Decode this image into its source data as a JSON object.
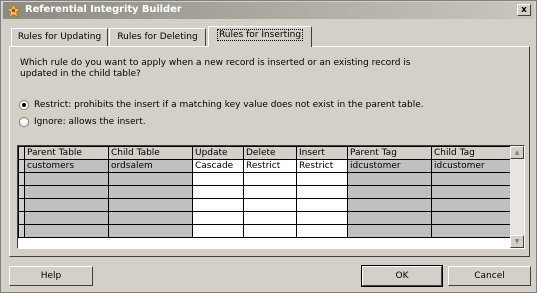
{
  "window": {
    "title": "Referential Integrity Builder",
    "close_glyph": "x"
  },
  "tabs": [
    {
      "label": "Rules for Updating",
      "active": false
    },
    {
      "label": "Rules for Deleting",
      "active": false
    },
    {
      "label": "Rules for Inserting",
      "active": true
    }
  ],
  "question": "Which rule do you want to apply when a new record is inserted or an existing record is updated in the child table?",
  "options": [
    {
      "label": "Restrict: prohibits the insert if a matching key value does not exist in the parent table.",
      "checked": true
    },
    {
      "label": "Ignore: allows the insert.",
      "checked": false
    }
  ],
  "grid": {
    "columns": [
      "Parent Table",
      "Child Table",
      "Update",
      "Delete",
      "Insert",
      "Parent Tag",
      "Child Tag"
    ],
    "rows": [
      [
        "customers",
        "ordsalem",
        "Cascade",
        "Restrict",
        "Restrict",
        "idcustomer",
        "idcustomer"
      ],
      [
        "",
        "",
        "",
        "",
        "",
        "",
        ""
      ],
      [
        "",
        "",
        "",
        "",
        "",
        "",
        ""
      ],
      [
        "",
        "",
        "",
        "",
        "",
        "",
        ""
      ],
      [
        "",
        "",
        "",
        "",
        "",
        "",
        ""
      ],
      [
        "",
        "",
        "",
        "",
        "",
        "",
        ""
      ]
    ]
  },
  "buttons": {
    "help": "Help",
    "ok": "OK",
    "cancel": "Cancel"
  },
  "icons": {
    "app": "builder-icon",
    "scroll_up": "arrow-up-icon",
    "scroll_down": "arrow-down-icon"
  }
}
